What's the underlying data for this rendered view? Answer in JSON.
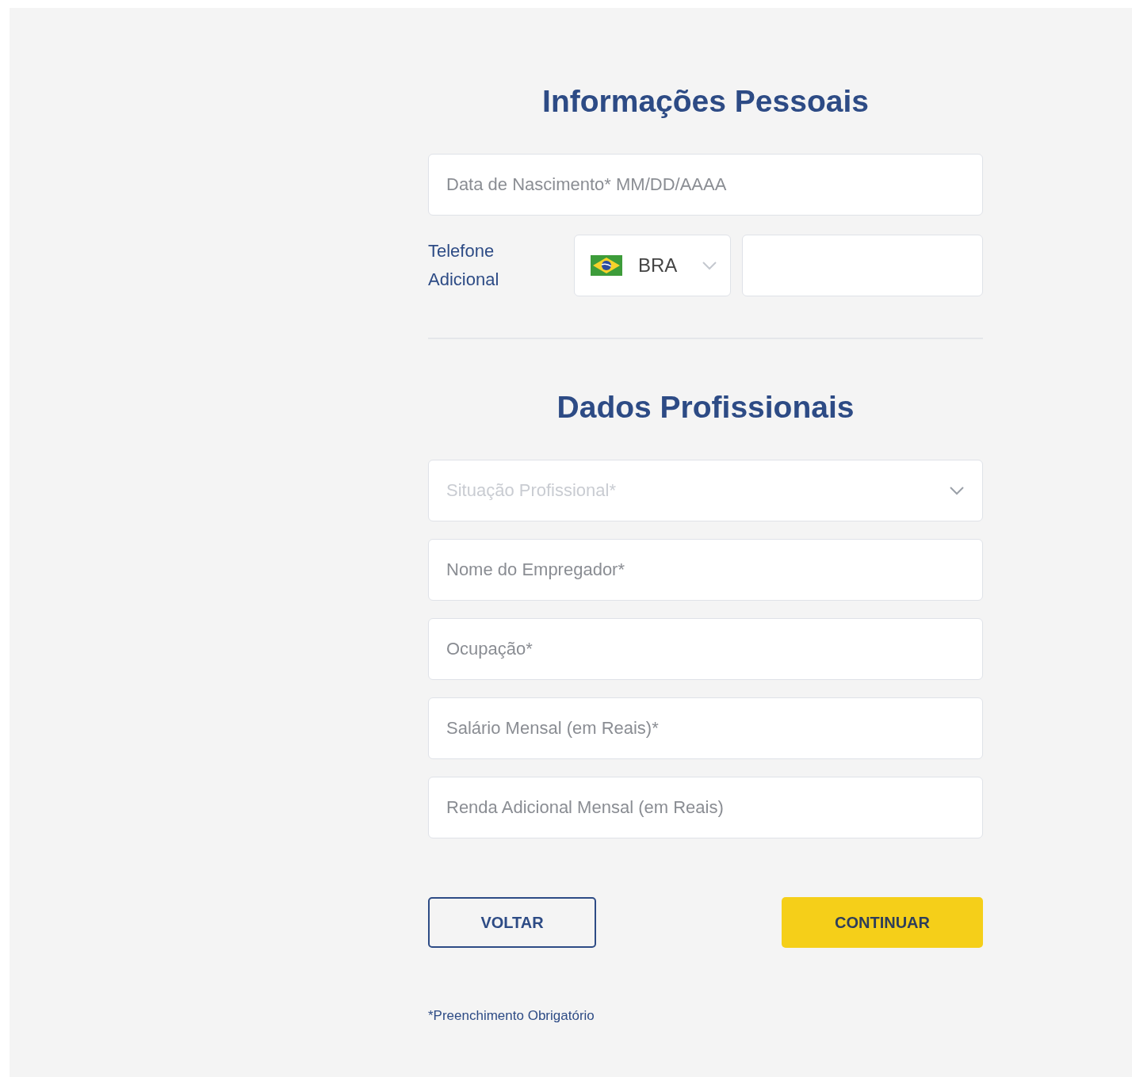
{
  "sections": [
    {
      "title": "Informações Pessoais",
      "fields": [
        {
          "kind": "text",
          "placeholder": "Data de Nascimento* MM/DD/AAAA"
        },
        {
          "kind": "phone",
          "label": "Telefone Adicional",
          "country": "BRA"
        }
      ]
    },
    {
      "title": "Dados Profissionais",
      "fields": [
        {
          "kind": "select",
          "placeholder": "Situação Profissional*"
        },
        {
          "kind": "text",
          "placeholder": "Nome do Empregador*"
        },
        {
          "kind": "text",
          "placeholder": "Ocupação*"
        },
        {
          "kind": "text",
          "placeholder": "Salário Mensal (em Reais)*"
        },
        {
          "kind": "text",
          "placeholder": "Renda Adicional Mensal (em Reais)"
        }
      ]
    }
  ],
  "buttons": [
    {
      "label": "VOLTAR",
      "kind": "secondary"
    },
    {
      "label": "CONTINUAR",
      "kind": "primary"
    }
  ],
  "footnote": "*Preenchimento Obrigatório"
}
